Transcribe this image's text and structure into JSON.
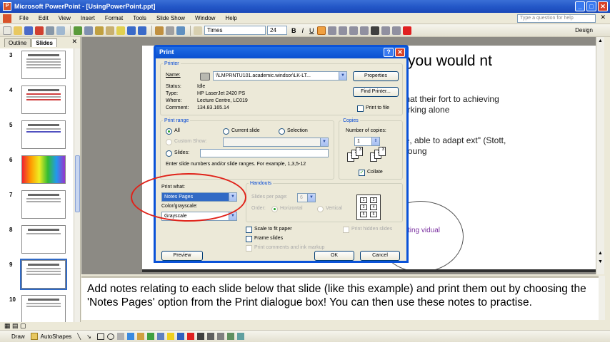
{
  "window": {
    "title": "Microsoft PowerPoint - [UsingPowerPoint.ppt]"
  },
  "menu": {
    "items": [
      "File",
      "Edit",
      "View",
      "Insert",
      "Format",
      "Tools",
      "Slide Show",
      "Window",
      "Help"
    ],
    "help_placeholder": "Type a question for help"
  },
  "toolbar": {
    "font": "Times",
    "size": "24",
    "bold": "B",
    "italic": "I",
    "underline": "U",
    "design": "Design"
  },
  "pane": {
    "tabs": [
      "Outline",
      "Slides"
    ],
    "slide_numbers": [
      "3",
      "4",
      "5",
      "6",
      "7",
      "8",
      "9",
      "10"
    ]
  },
  "slide": {
    "title": "you would nt",
    "body1": "that their fort to achieving orking alone",
    "body2": "le, able to adapt ext\" (Stott, Young",
    "venn_text": "ting vidual"
  },
  "notes": {
    "text": "Add notes relating to each slide below that slide (like this example) and print them out by choosing the 'Notes Pages' option from the Print dialogue box! You can then use these notes to practise."
  },
  "drawbar": {
    "draw": "Draw",
    "autoshapes": "AutoShapes"
  },
  "dialog": {
    "title": "Print",
    "printer_group": "Printer",
    "name_label": "Name:",
    "name_value": "\\\\LMPRNTU101.academic.windsor\\LK-LT...",
    "properties": "Properties",
    "find_printer": "Find Printer...",
    "print_to_file": "Print to file",
    "status_label": "Status:",
    "status_value": "Idle",
    "type_label": "Type:",
    "type_value": "HP LaserJet 2420 PS",
    "where_label": "Where:",
    "where_value": "Lecture Centre, LC019",
    "comment_label": "Comment:",
    "comment_value": "134.83.165.14",
    "range_group": "Print range",
    "all": "All",
    "current_slide": "Current slide",
    "selection": "Selection",
    "custom_show": "Custom Show:",
    "slides": "Slides:",
    "slides_hint": "Enter slide numbers and/or slide ranges. For example, 1,3,5-12",
    "copies_group": "Copies",
    "copies_label": "Number of copies:",
    "copies_value": "1",
    "collate": "Collate",
    "print_what_label": "Print what:",
    "print_what_value": "Notes Pages",
    "color_label": "Color/grayscale:",
    "color_value": "Grayscale",
    "handouts_group": "Handouts",
    "slides_per_page": "Slides per page:",
    "slides_per_page_value": "6",
    "order": "Order:",
    "horizontal": "Horizontal",
    "vertical": "Vertical",
    "scale_to_fit": "Scale to fit paper",
    "frame_slides": "Frame slides",
    "print_comments": "Print comments and ink markup",
    "print_hidden": "Print hidden slides",
    "preview": "Preview",
    "ok": "OK",
    "cancel": "Cancel"
  }
}
